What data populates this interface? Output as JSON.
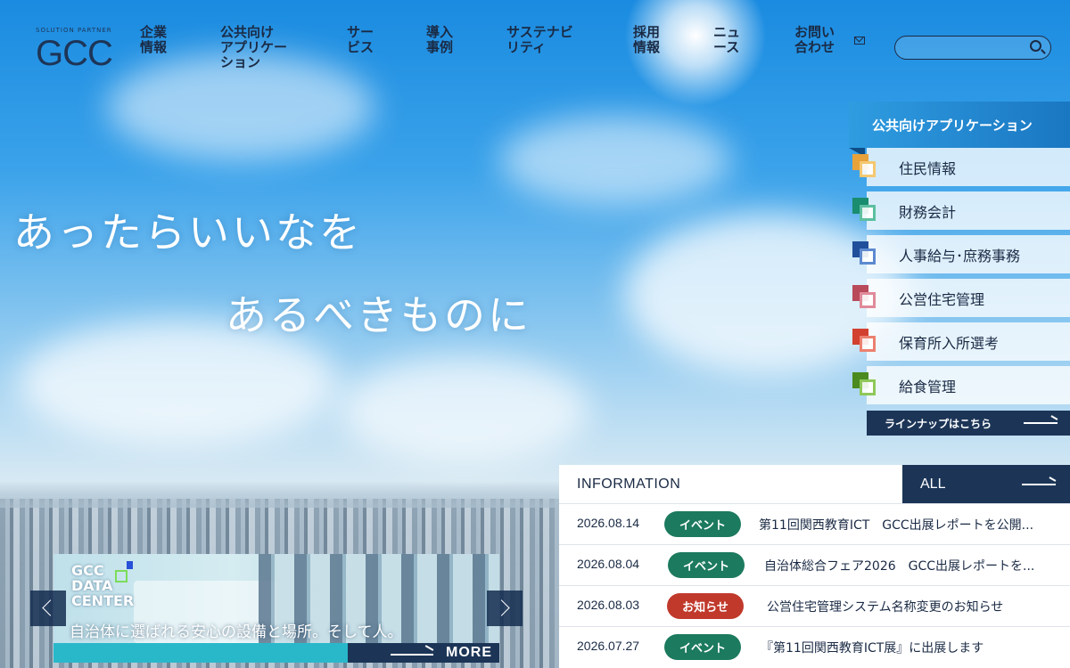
{
  "logo": {
    "sub": "SOLUTION PARTNER",
    "main": "GCC"
  },
  "nav": [
    {
      "label": "企業\n情報"
    },
    {
      "label": "公共向け\nアプリケー\nション"
    },
    {
      "label": "サー\nビス"
    },
    {
      "label": "導入\n事例"
    },
    {
      "label": "サステナビ\nリティ"
    },
    {
      "label": "採用\n情報"
    },
    {
      "label": "ニュ\nース"
    },
    {
      "label": "お問い\n合わせ"
    }
  ],
  "search": {
    "placeholder": "",
    "value": ""
  },
  "hero": {
    "line1": "あったらいいなを",
    "line2": "あるべきものに"
  },
  "apps": {
    "title": "公共向けアプリケーション",
    "items": [
      {
        "label": "住民情報",
        "color": "#e8a23a",
        "light": "#f4c870"
      },
      {
        "label": "財務会計",
        "color": "#1a8c6f",
        "light": "#5cbf9f"
      },
      {
        "label": "人事給与･庶務事務",
        "color": "#1f4f9a",
        "light": "#5d8ad0"
      },
      {
        "label": "公営住宅管理",
        "color": "#b84a5a",
        "light": "#e08a9a"
      },
      {
        "label": "保育所入所選考",
        "color": "#d24030",
        "light": "#ec8070"
      },
      {
        "label": "給食管理",
        "color": "#4a8a1e",
        "light": "#8ec85a"
      }
    ],
    "lineup": "ラインナップはこちら"
  },
  "banner": {
    "title": "GCC\nDATA\nCENTER",
    "caption": "自治体に選ばれる安心の設備と場所。そして人。",
    "more": "MORE",
    "progress_fraction": 0.66
  },
  "info": {
    "heading": "INFORMATION",
    "all": "ALL",
    "colors": {
      "event": "#1c7a5e",
      "notice": "#c0392b"
    },
    "rows": [
      {
        "date": "2026.08.14",
        "badge": "イベント",
        "type": "event",
        "title": "第11回関西教育ICT　GCC出展レポートを公開..."
      },
      {
        "date": "2026.08.04",
        "badge": "イベント",
        "type": "event",
        "title": "自治体総合フェア2026　GCC出展レポートを..."
      },
      {
        "date": "2026.08.03",
        "badge": "お知らせ",
        "type": "notice",
        "title": "公営住宅管理システム名称変更のお知らせ"
      },
      {
        "date": "2026.07.27",
        "badge": "イベント",
        "type": "event",
        "title": "『第11回関西教育ICT展』に出展します"
      }
    ]
  }
}
